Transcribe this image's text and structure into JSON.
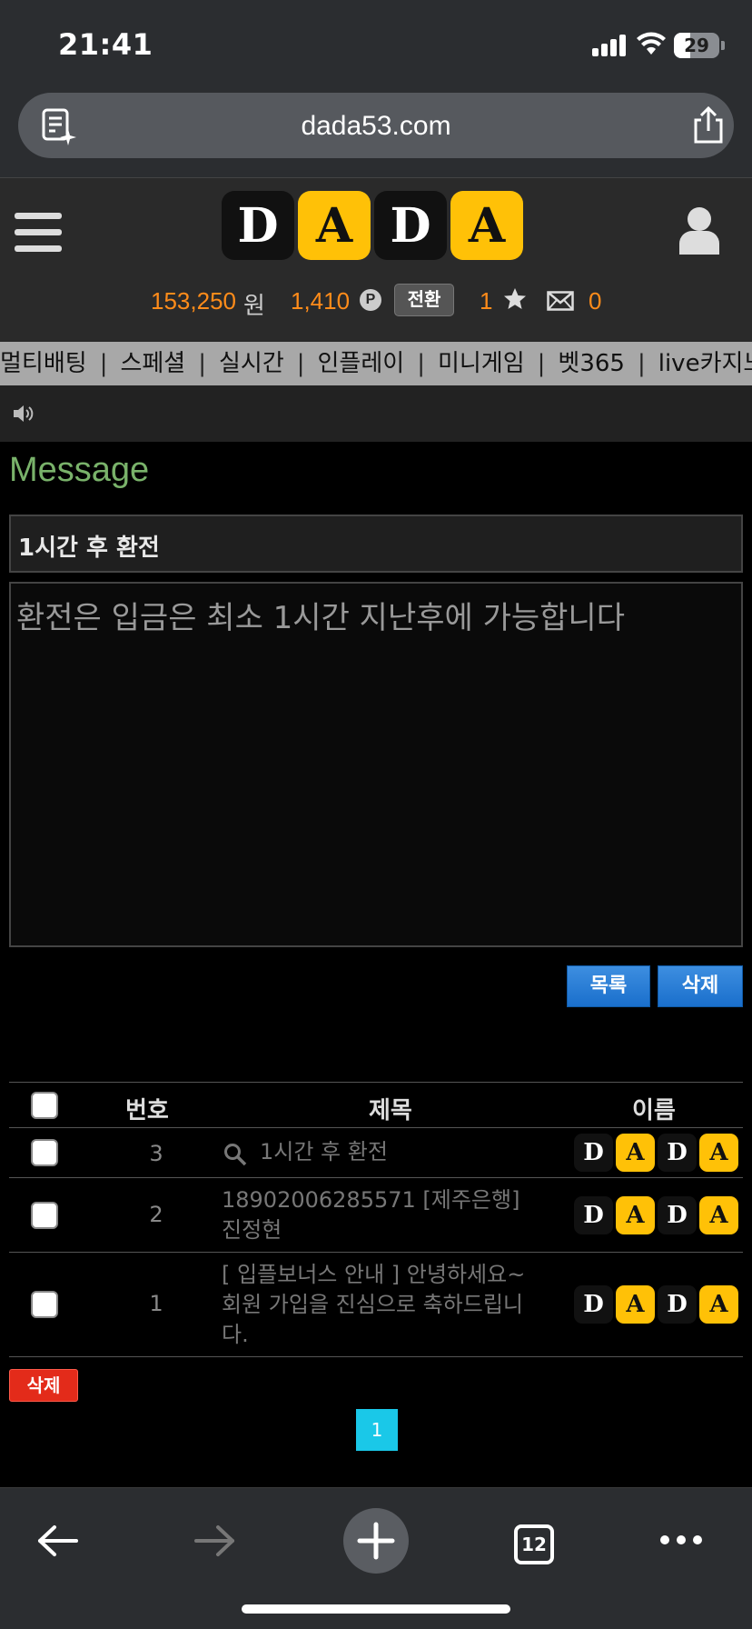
{
  "status_bar": {
    "time": "21:41",
    "battery": "29"
  },
  "browser": {
    "url": "dada53.com",
    "tab_count": "12"
  },
  "header": {
    "logo_letters": [
      "D",
      "A",
      "D",
      "A"
    ],
    "balance": "153,250",
    "balance_unit": "원",
    "points": "1,410",
    "points_icon": "P",
    "convert_label": "전환",
    "star_count": "1",
    "mail_count": "0"
  },
  "nav": {
    "items": [
      "멀티배팅",
      "스페셜",
      "실시간",
      "인플레이",
      "미니게임",
      "벳365",
      "live카지노"
    ],
    "separator": "|"
  },
  "message": {
    "page_title": "Message",
    "subject": "1시간 후 환전",
    "body": "환전은 입금은 최소 1시간 지난후에 가능합니다",
    "list_button": "목록",
    "delete_button": "삭제"
  },
  "table": {
    "headers": {
      "number": "번호",
      "subject": "제목",
      "name": "이름"
    },
    "rows": [
      {
        "number": "3",
        "subject": "1시간 후 환전"
      },
      {
        "number": "2",
        "subject_line1": "18902006285571 [제주은행]",
        "subject_line2": "진정현"
      },
      {
        "number": "1",
        "subject_line1": "[ 입플보너스 안내 ] 안녕하세요~",
        "subject_line2": "회원 가입을 진심으로 축하드립니",
        "subject_line3": "다."
      }
    ],
    "delete_button": "삭제",
    "current_page": "1"
  },
  "colors": {
    "accent_orange": "#ff8c1a",
    "title_green": "#79b26a",
    "logo_yellow": "#ffc107",
    "button_blue": "#1a6fcc",
    "button_red": "#e32b1a",
    "page_cyan": "#1ac8e8"
  },
  "icons": [
    "reader-icon",
    "share-icon",
    "menu-icon",
    "user-icon",
    "points-icon",
    "star-icon",
    "mail-icon",
    "speaker-icon",
    "search-icon",
    "back-icon",
    "forward-icon",
    "plus-icon",
    "tabs-icon",
    "more-icon"
  ]
}
